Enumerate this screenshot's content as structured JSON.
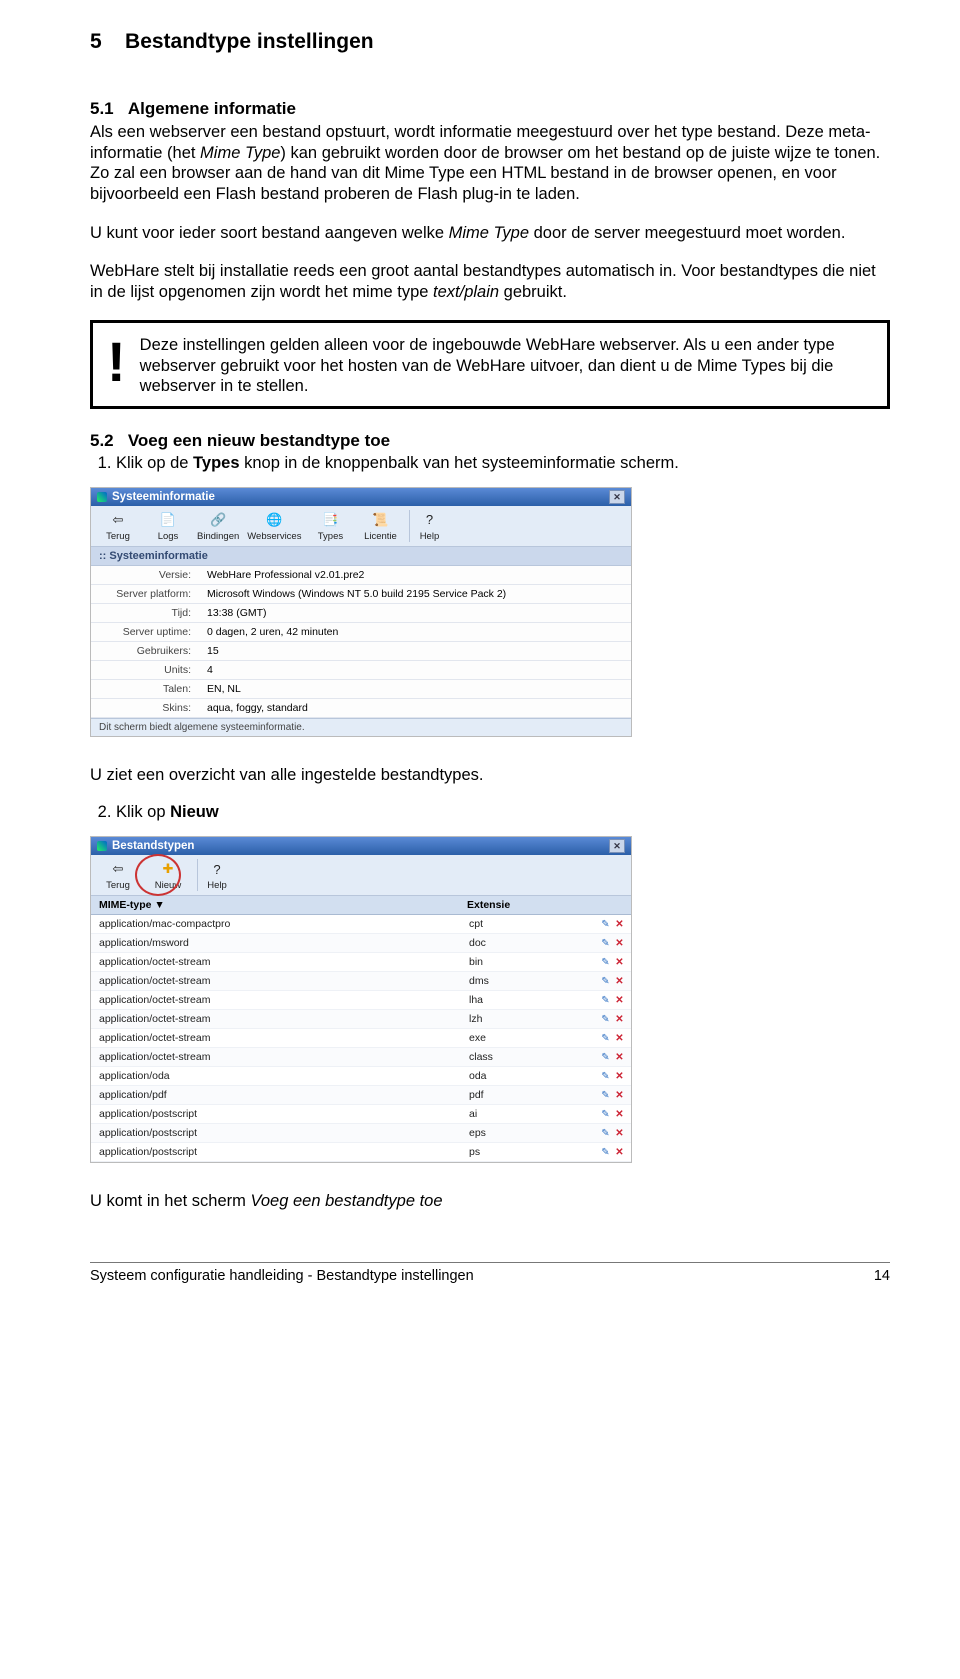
{
  "headings": {
    "main_num": "5",
    "main_title": "Bestandtype instellingen",
    "s1_num": "5.1",
    "s1_title": "Algemene informatie",
    "s2_num": "5.2",
    "s2_title": "Voeg een nieuw bestandtype toe"
  },
  "text": {
    "p1a": "Als een webserver een bestand opstuurt, wordt informatie meegestuurd over het type bestand. Deze meta-informatie (het ",
    "p1b": "Mime Type",
    "p1c": ") kan gebruikt worden door de browser om het bestand op de juiste wijze te tonen.",
    "p2": "Zo zal een browser aan de hand van dit Mime Type een HTML bestand in de browser openen, en voor bijvoorbeeld een Flash bestand proberen de Flash plug-in te laden.",
    "p3a": "U kunt voor ieder soort bestand aangeven welke ",
    "p3b": "Mime Type",
    "p3c": " door de server meegestuurd moet worden.",
    "p4a": "WebHare stelt bij installatie reeds een groot aantal bestandtypes automatisch in. Voor bestandtypes die niet in de lijst opgenomen zijn wordt het mime type ",
    "p4b": "text/plain",
    "p4c": " gebruikt.",
    "callout": "Deze instellingen gelden alleen voor de ingebouwde WebHare webserver. Als u een ander type webserver gebruikt voor het hosten van de WebHare uitvoer, dan dient u de Mime Types bij die webserver in te stellen.",
    "step1a": "Klik op de ",
    "step1b": "Types",
    "step1c": " knop in de knoppenbalk van het systeeminformatie scherm.",
    "afterimg1": "U ziet een overzicht van alle ingestelde bestandtypes.",
    "step2a": "Klik op ",
    "step2b": "Nieuw",
    "afterimg2a": "U komt in het scherm ",
    "afterimg2b": "Voeg een bestandtype toe"
  },
  "win1": {
    "title": "Systeeminformatie",
    "toolbar": [
      "Terug",
      "Logs",
      "Bindingen",
      "Webservices",
      "Types",
      "Licentie",
      "Help"
    ],
    "toolbar_glyphs": [
      "⇦",
      "📄",
      "🔗",
      "🌐",
      "📑",
      "📜",
      "?"
    ],
    "bar": ":: Systeeminformatie",
    "rows": [
      [
        "Versie:",
        "WebHare Professional v2.01.pre2"
      ],
      [
        "Server platform:",
        "Microsoft Windows (Windows NT 5.0 build 2195 Service Pack 2)"
      ],
      [
        "Tijd:",
        "13:38 (GMT)"
      ],
      [
        "Server uptime:",
        "0 dagen, 2 uren, 42 minuten"
      ],
      [
        "Gebruikers:",
        "15"
      ],
      [
        "Units:",
        "4"
      ],
      [
        "Talen:",
        "EN, NL"
      ],
      [
        "Skins:",
        "aqua, foggy, standard"
      ]
    ],
    "status": "Dit scherm biedt algemene systeeminformatie."
  },
  "win2": {
    "title": "Bestandstypen",
    "toolbar": [
      "Terug",
      "Nieuw",
      "Help"
    ],
    "toolbar_glyphs": [
      "⇦",
      "✚",
      "?"
    ],
    "col1": "MIME-type ▼",
    "col2": "Extensie",
    "rows": [
      [
        "application/mac-compactpro",
        "cpt"
      ],
      [
        "application/msword",
        "doc"
      ],
      [
        "application/octet-stream",
        "bin"
      ],
      [
        "application/octet-stream",
        "dms"
      ],
      [
        "application/octet-stream",
        "lha"
      ],
      [
        "application/octet-stream",
        "lzh"
      ],
      [
        "application/octet-stream",
        "exe"
      ],
      [
        "application/octet-stream",
        "class"
      ],
      [
        "application/oda",
        "oda"
      ],
      [
        "application/pdf",
        "pdf"
      ],
      [
        "application/postscript",
        "ai"
      ],
      [
        "application/postscript",
        "eps"
      ],
      [
        "application/postscript",
        "ps"
      ]
    ]
  },
  "footer": {
    "left": "Systeem configuratie handleiding - Bestandtype instellingen",
    "right": "14"
  }
}
